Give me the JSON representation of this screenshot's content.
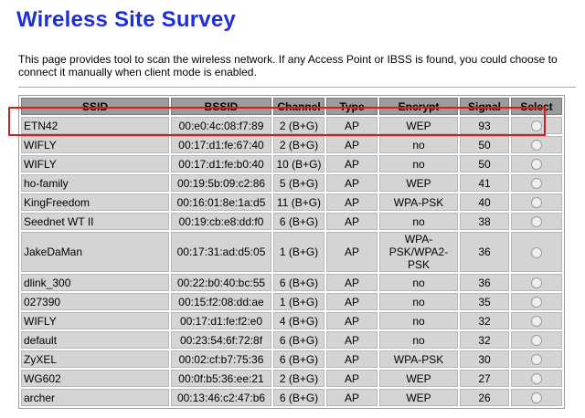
{
  "page": {
    "title": "Wireless Site Survey",
    "description": "This page provides tool to scan the wireless network. If any Access Point or IBSS is found, you could choose to connect it manually when client mode is enabled."
  },
  "colors": {
    "title": "#1f2fd6",
    "header_bg": "#9c9c9c",
    "cell_bg": "#d4d4d4",
    "highlight": "#e01818"
  },
  "table": {
    "headers": [
      "SSID",
      "BSSID",
      "Channel",
      "Type",
      "Encrypt",
      "Signal",
      "Select"
    ],
    "rows": [
      {
        "ssid": "ETN42",
        "bssid": "00:e0:4c:08:f7:89",
        "channel": "2 (B+G)",
        "type": "AP",
        "encrypt": "WEP",
        "signal": "93"
      },
      {
        "ssid": "WIFLY",
        "bssid": "00:17:d1:fe:67:40",
        "channel": "2 (B+G)",
        "type": "AP",
        "encrypt": "no",
        "signal": "50"
      },
      {
        "ssid": "WIFLY",
        "bssid": "00:17:d1:fe:b0:40",
        "channel": "10 (B+G)",
        "type": "AP",
        "encrypt": "no",
        "signal": "50"
      },
      {
        "ssid": "ho-family",
        "bssid": "00:19:5b:09:c2:86",
        "channel": "5 (B+G)",
        "type": "AP",
        "encrypt": "WEP",
        "signal": "41"
      },
      {
        "ssid": "KingFreedom",
        "bssid": "00:16:01:8e:1a:d5",
        "channel": "11 (B+G)",
        "type": "AP",
        "encrypt": "WPA-PSK",
        "signal": "40"
      },
      {
        "ssid": "Seednet WT II",
        "bssid": "00:19:cb:e8:dd:f0",
        "channel": "6 (B+G)",
        "type": "AP",
        "encrypt": "no",
        "signal": "38"
      },
      {
        "ssid": "JakeDaMan",
        "bssid": "00:17:31:ad:d5:05",
        "channel": "1 (B+G)",
        "type": "AP",
        "encrypt": "WPA-PSK/WPA2-PSK",
        "signal": "36"
      },
      {
        "ssid": "dlink_300",
        "bssid": "00:22:b0:40:bc:55",
        "channel": "6 (B+G)",
        "type": "AP",
        "encrypt": "no",
        "signal": "36"
      },
      {
        "ssid": "027390",
        "bssid": "00:15:f2:08:dd:ae",
        "channel": "1 (B+G)",
        "type": "AP",
        "encrypt": "no",
        "signal": "35"
      },
      {
        "ssid": "WIFLY",
        "bssid": "00:17:d1:fe:f2:e0",
        "channel": "4 (B+G)",
        "type": "AP",
        "encrypt": "no",
        "signal": "32"
      },
      {
        "ssid": "default",
        "bssid": "00:23:54:6f:72:8f",
        "channel": "6 (B+G)",
        "type": "AP",
        "encrypt": "no",
        "signal": "32"
      },
      {
        "ssid": "ZyXEL",
        "bssid": "00:02:cf:b7:75:36",
        "channel": "6 (B+G)",
        "type": "AP",
        "encrypt": "WPA-PSK",
        "signal": "30"
      },
      {
        "ssid": "WG602",
        "bssid": "00:0f:b5:36:ee:21",
        "channel": "2 (B+G)",
        "type": "AP",
        "encrypt": "WEP",
        "signal": "27"
      },
      {
        "ssid": "archer",
        "bssid": "00:13:46:c2:47:b6",
        "channel": "6 (B+G)",
        "type": "AP",
        "encrypt": "WEP",
        "signal": "26"
      }
    ]
  }
}
